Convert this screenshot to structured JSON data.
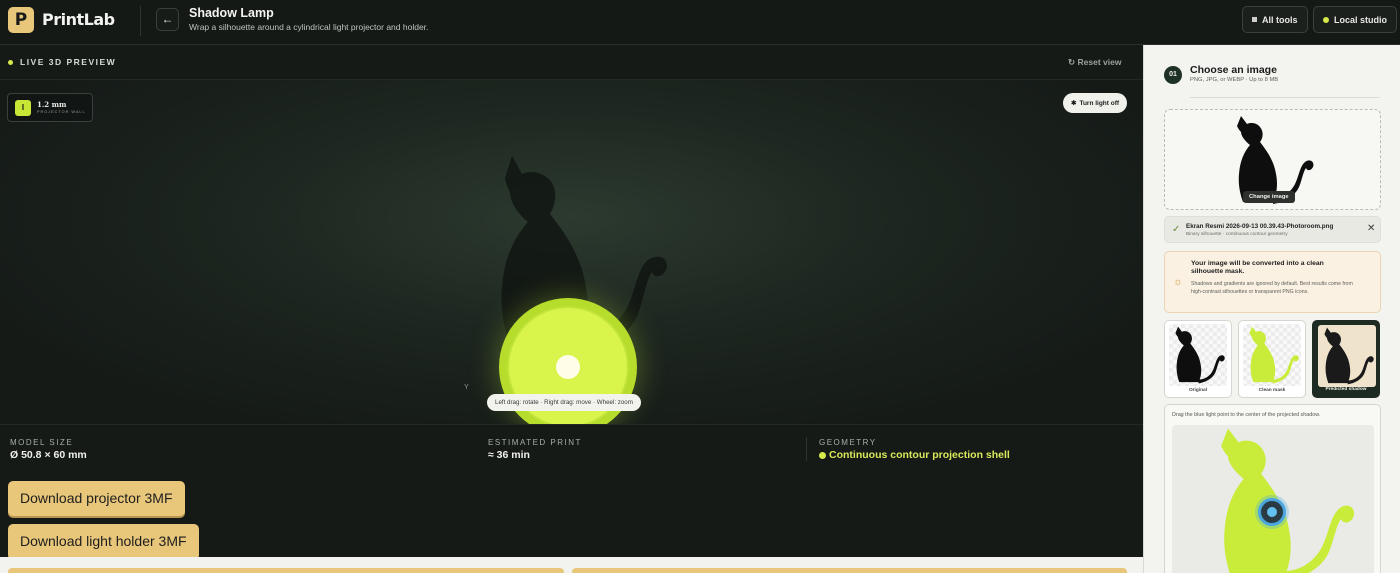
{
  "header": {
    "logo_letter": "P",
    "brand": "PrintLab",
    "back_icon": "arrow-left-icon",
    "title": "Shadow Lamp",
    "subtitle": "Wrap a silhouette around a cylindrical light projector and holder.",
    "all_tools": "All tools",
    "local_studio": "Local studio"
  },
  "preview": {
    "live_label": "LIVE 3D PREVIEW",
    "reset_view": "Reset view",
    "dim_value": "1.2 mm",
    "dim_label": "PROJECTOR WALL",
    "dim_icon_text": "I",
    "turn_light_off": "Turn light off",
    "axis_label": "Y",
    "hint": "Left drag: rotate · Right drag: move · Wheel: zoom",
    "accent": "#d8e94b"
  },
  "stats": {
    "model_size_label": "MODEL SIZE",
    "model_size_value": "Ø 50.8 × 60 mm",
    "print_label": "ESTIMATED PRINT",
    "print_value": "≈ 36 min",
    "geometry_label": "GEOMETRY",
    "geometry_value": "Continuous contour projection shell"
  },
  "downloads": {
    "projector": "Download projector 3MF",
    "holder": "Download light holder 3MF"
  },
  "panel": {
    "step": "01",
    "title": "Choose an image",
    "subtitle": "PNG, JPG, or WEBP · Up to 8 MB",
    "change_image": "Change image",
    "file_name": "Ekran Resmi 2026-09-13 00.39.43-Photoroom.png",
    "file_meta": "Binary silhouette · continuous contour geometry",
    "note_title": "Your image will be converted into a clean silhouette mask.",
    "note_body": "Shadows and gradients are ignored by default. Best results come from high-contrast silhouettes or transparent PNG icons.",
    "thumbs": [
      "Original",
      "Clean mask",
      "Predicted shadow"
    ],
    "drag_hint": "Drag the blue light point to the center of the projected shadow."
  }
}
